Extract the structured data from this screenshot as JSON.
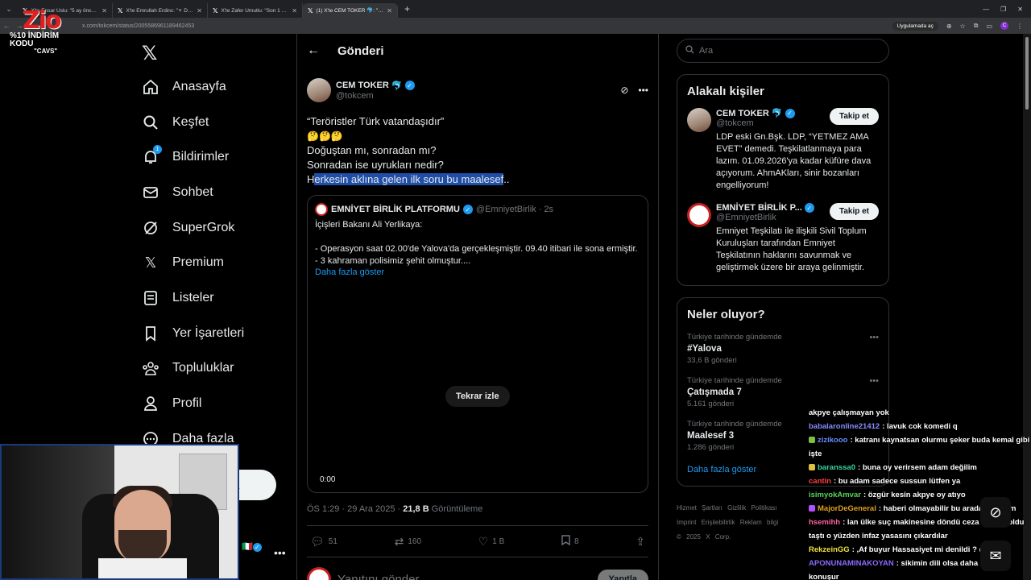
{
  "browser": {
    "tabs": [
      {
        "title": "X'te Ensar Uslu: \"5 ay önce http:"
      },
      {
        "title": "X'te Emrullah Erdinc: \"⚪ DEA"
      },
      {
        "title": "X'te Zafer Umutlu: \"Son 1 sene"
      },
      {
        "title": "(1) X'te CEM TOKER 🐬: \"Terör"
      }
    ],
    "url": "x.com/tokcem/status/2005586961189462453",
    "open_in_app": "Uygulamada aç",
    "profile_letter": "C"
  },
  "streamer": {
    "logo": "Zio",
    "promo": "%10 İNDİRİM KODU",
    "code": "\"CAVS\""
  },
  "nav": {
    "items": [
      {
        "label": "Anasayfa",
        "icon": "home-icon"
      },
      {
        "label": "Keşfet",
        "icon": "search-icon"
      },
      {
        "label": "Bildirimler",
        "icon": "bell-icon",
        "badge": "1"
      },
      {
        "label": "Sohbet",
        "icon": "mail-icon"
      },
      {
        "label": "SuperGrok",
        "icon": "grok-icon"
      },
      {
        "label": "Premium",
        "icon": "x-icon"
      },
      {
        "label": "Listeler",
        "icon": "list-icon"
      },
      {
        "label": "Yer İşaretleri",
        "icon": "bookmark-icon"
      },
      {
        "label": "Topluluklar",
        "icon": "people-icon"
      },
      {
        "label": "Profil",
        "icon": "person-icon"
      },
      {
        "label": "Daha fazla",
        "icon": "more-icon"
      }
    ],
    "post_button_partial": "a"
  },
  "main": {
    "title": "Gönderi",
    "post": {
      "name": "CEM TOKER",
      "name_emoji": "🐬",
      "handle": "@tokcem",
      "line1": "“Teröristler Türk vatandaşıdır”",
      "emojis": "🤔🤔🤔",
      "line2": "Doğuştan mı, sonradan mı?",
      "line3": "Sonradan ise uyrukları nedir?",
      "line4_first": "H",
      "line4_highlight": "erkesin aklına gelen ilk soru bu maalesef",
      "line4_end": "..",
      "time": "ÖS 1:29 · 29 Ara 2025 · ",
      "views": "21,8 B",
      "views_label": " Görüntüleme",
      "replies": "51",
      "reposts": "160",
      "likes": "1 B",
      "bookmarks": "8"
    },
    "quote": {
      "name": "EMNİYET BİRLİK PLATFORMU",
      "handle": "@EmniyetBirlik · 2s",
      "line1": "İçişleri Bakanı Ali Yerlikaya:",
      "line2": "- Operasyon saat 02.00'de Yalova'da gerçekleşmiştir. 09.40 itibari ile sona ermiştir.",
      "line3": "- 3 kahraman polisimiz şehit olmuştur....",
      "show_more": "Daha fazla göster",
      "replay": "Tekrar izle",
      "video_time": "0:00"
    },
    "reply": {
      "placeholder": "Yanıtını gönder",
      "button": "Yanıtla"
    }
  },
  "right": {
    "search_placeholder": "Ara",
    "related_title": "Alakalı kişiler",
    "people": [
      {
        "name": "CEM TOKER",
        "name_emoji": "🐬",
        "handle": "@tokcem",
        "follow": "Takip et",
        "bio": "LDP eski Gn.Bşk. LDP, “YETMEZ AMA EVET” demedi. Teşkilatlanmaya para lazım. 01.09.2026'ya kadar küfüre dava açıyorum. AhmAKları, sinir bozanları engelliyorum!"
      },
      {
        "name": "EMNİYET BİRLİK P...",
        "name_emoji": "",
        "handle": "@EmniyetBirlik",
        "follow": "Takip et",
        "bio": "Emniyet Teşkilatı ile ilişkili Sivil Toplum Kuruluşları tarafından Emniyet Teşkilatının haklarını savunmak ve geliştirmek üzere bir araya gelinmiştir."
      }
    ],
    "trends_title": "Neler oluyor?",
    "trends": [
      {
        "context": "Türkiye tarihinde gündemde",
        "name": "#Yalova",
        "count": "33,6 B gönderi"
      },
      {
        "context": "Türkiye tarihinde gündemde",
        "name": "Çatışmada 7",
        "count": "5.161 gönderi"
      },
      {
        "context": "Türkiye tarihinde gündemde",
        "name": "Maalesef 3",
        "count": "1.286 gönderi"
      }
    ],
    "trends_more": "Daha fazla göster",
    "footer": [
      "Hizmet Şartları",
      "Gizlilik Politikası",
      "Imprint",
      "Erişilebilirlik",
      "Reklam bilgi",
      "© 2025 X Corp."
    ]
  },
  "chat": [
    {
      "user": "",
      "color": "#ffffff",
      "badge": "",
      "text": "akpye çalışmayan yok"
    },
    {
      "user": "babalaronline21412",
      "color": "#8a8aff",
      "badge": "",
      "text": ": lavuk cok komedi q"
    },
    {
      "user": "zizikooo",
      "color": "#6b8cff",
      "badge": "#7ac142",
      "text": ": katranı kaynatsan olurmu şeker buda kemal gibi işte"
    },
    {
      "user": "baranssa0",
      "color": "#3ad4a0",
      "badge": "#e0c040",
      "text": ": buna oy verirsem adam değilim"
    },
    {
      "user": "cantin",
      "color": "#ff4040",
      "badge": "",
      "text": ": bu adam sadece sussun lütfen ya"
    },
    {
      "user": "isimyokAmvar",
      "color": "#5ad35a",
      "badge": "",
      "text": ": özgür kesin akpye oy atıyo"
    },
    {
      "user": "MajorDeGeneral",
      "color": "#e0a020",
      "badge": "#b050ff",
      "text": ": haberi olmayabilir bu arada ciddiyim"
    },
    {
      "user": "hsemihh",
      "color": "#ff60a0",
      "badge": "",
      "text": ": lan ülke suç makinesine döndü ceza evleri doldu taştı o yüzden infaz yasasını çıkardılar"
    },
    {
      "user": "RekzeinGG",
      "color": "#f0e040",
      "badge": "",
      "text": ": ,Af buyur Hassasiyet mi denildi ? @cavs"
    },
    {
      "user": "APONUNAMINAKOYAN",
      "color": "#8a6aff",
      "badge": "",
      "text": ": sikimin dili olsa daha anlamlı konuşur"
    }
  ]
}
